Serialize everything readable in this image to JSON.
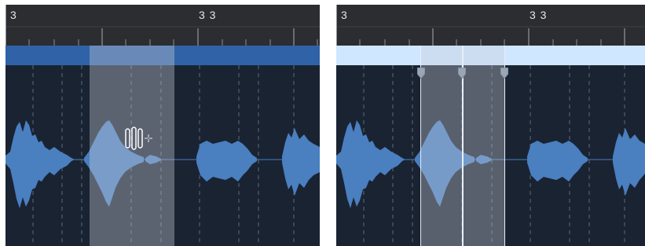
{
  "left_panel": {
    "ruler": {
      "bar_label": "3",
      "beat_label": "3 3"
    },
    "cursor": {
      "icon": "marquee-stretch-plus-icon"
    },
    "colors": {
      "region_bar": "#2f62a6",
      "waveform": "#4a7fc0",
      "selection": "rgba(200,205,215,0.38)"
    }
  },
  "right_panel": {
    "ruler": {
      "bar_label": "3",
      "beat_label": "3 3"
    },
    "colors": {
      "region_bar": "#cfe7ff",
      "waveform": "#4a7fc0",
      "selection_border": "#e8eef7"
    }
  }
}
